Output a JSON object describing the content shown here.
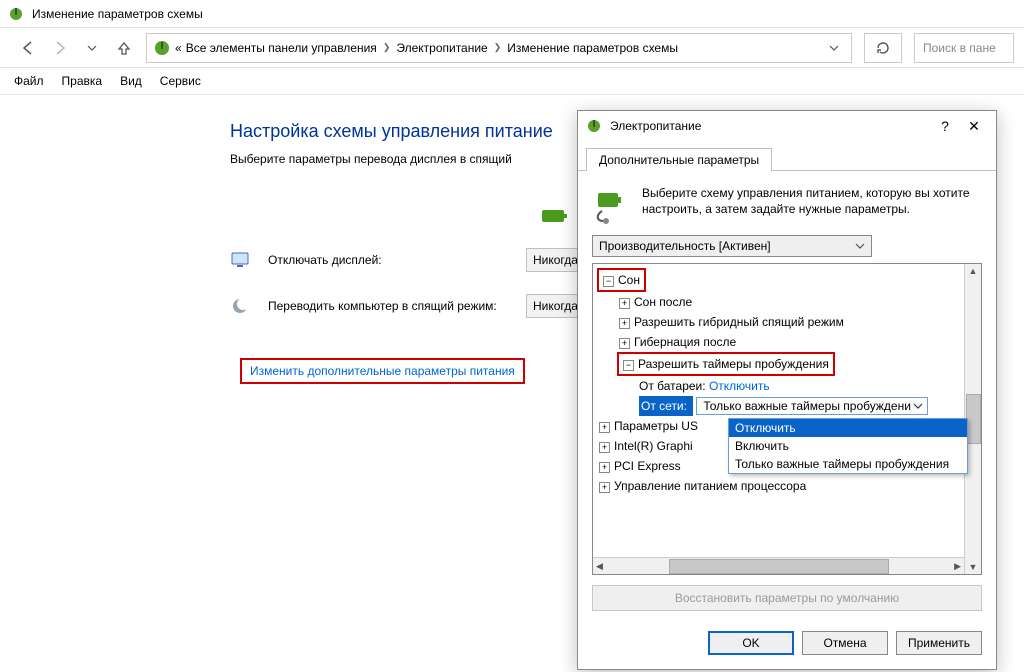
{
  "explorer": {
    "title": "Изменение параметров схемы",
    "breadcrumb": {
      "root": "«",
      "items": [
        "Все элементы панели управления",
        "Электропитание",
        "Изменение параметров схемы"
      ]
    },
    "search_placeholder": "Поиск в пане",
    "menus": [
      "Файл",
      "Правка",
      "Вид",
      "Сервис"
    ]
  },
  "page": {
    "heading": "Настройка схемы управления питание",
    "subtitle": "Выберите параметры перевода дисплея в спящий",
    "row_display": {
      "label": "Отключать дисплей:",
      "value": "Никогда"
    },
    "row_sleep": {
      "label": "Переводить компьютер в спящий режим:",
      "value": "Никогда"
    },
    "adv_link": "Изменить дополнительные параметры питания"
  },
  "dialog": {
    "title": "Электропитание",
    "tab": "Дополнительные параметры",
    "intro": "Выберите схему управления питанием, которую вы хотите настроить, а затем задайте нужные параметры.",
    "scheme": "Производительность [Активен]",
    "tree": {
      "sleep": "Сон",
      "sleep_after": "Сон после",
      "hybrid": "Разрешить гибридный спящий режим",
      "hibernate_after": "Гибернация после",
      "wake_timers": "Разрешить таймеры пробуждения",
      "on_battery_label": "От батареи:",
      "on_battery_value": "Отключить",
      "plugged_label": "От сети:",
      "plugged_value": "Только важные таймеры пробуждени",
      "usb": "Параметры US",
      "intel": "Intel(R) Graphi",
      "pci": "PCI Express",
      "cpu": "Управление питанием процессора"
    },
    "dropdown": {
      "opt1": "Отключить",
      "opt2": "Включить",
      "opt3": "Только важные таймеры пробуждения"
    },
    "restore": "Восстановить параметры по умолчанию",
    "ok": "OK",
    "cancel": "Отмена",
    "apply": "Применить"
  }
}
